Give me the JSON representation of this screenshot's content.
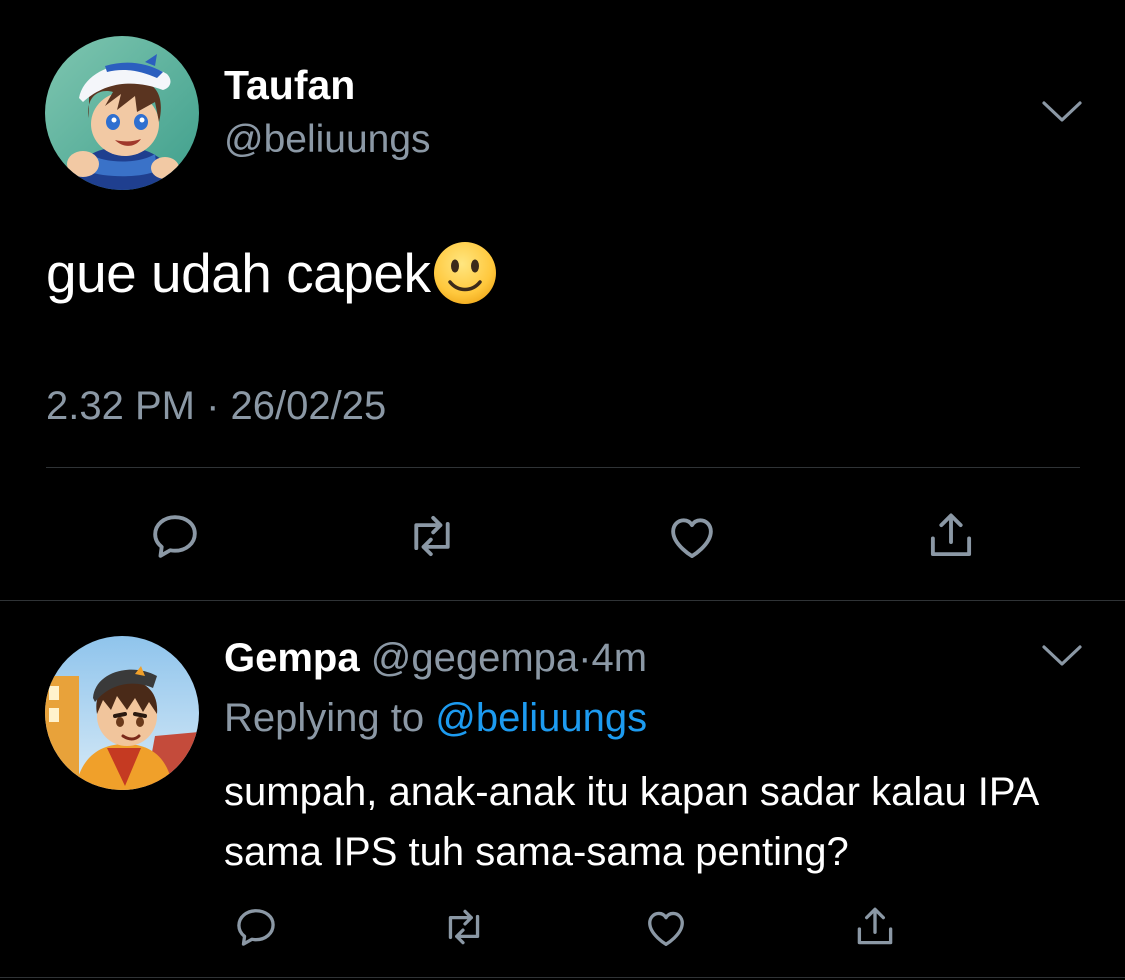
{
  "tweet": {
    "author_name": "Taufan",
    "author_handle": "@beliuungs",
    "text": "gue udah capek",
    "emoji": "slightly-smiling-face",
    "timestamp": "2.32 PM · 26/02/25",
    "actions": [
      "reply-icon",
      "retweet-icon",
      "like-icon",
      "share-icon"
    ]
  },
  "reply": {
    "author_name": "Gempa",
    "author_handle": "@gegempa",
    "separator": "·",
    "time_ago": "4m",
    "replying_prefix": "Replying to",
    "replying_handle": "@beliuungs",
    "text": "sumpah, anak-anak itu kapan sadar kalau IPA sama IPS tuh sama-sama penting?",
    "actions": [
      "reply-icon",
      "retweet-icon",
      "like-icon",
      "share-icon"
    ]
  },
  "colors": {
    "background": "#000000",
    "text_primary": "#ffffff",
    "text_secondary": "#8b98a5",
    "link": "#1d9bf0",
    "divider": "#2f3336"
  }
}
